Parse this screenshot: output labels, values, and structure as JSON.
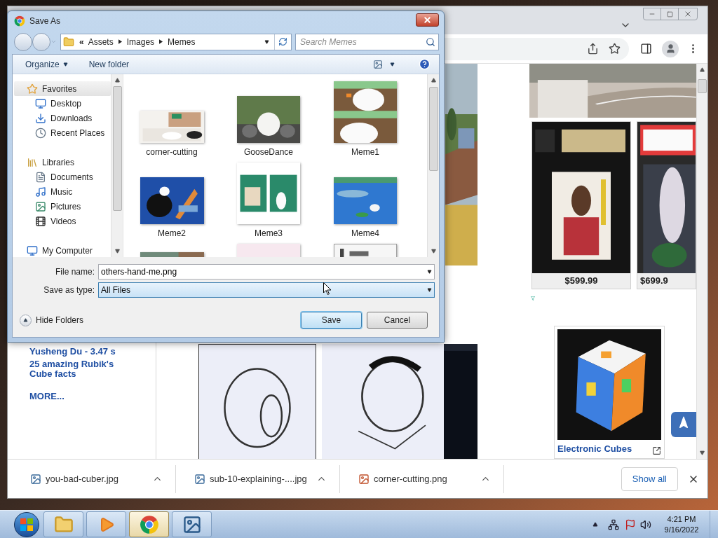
{
  "dialog": {
    "title": "Save As",
    "breadcrumb": {
      "overflow": "«",
      "folders": [
        "Assets",
        "Images",
        "Memes"
      ]
    },
    "search": {
      "placeholder": "Search Memes"
    },
    "toolbar": {
      "organize": "Organize",
      "new_folder": "New folder"
    },
    "nav_tree": [
      {
        "label": "Favorites",
        "kind": "favorites",
        "selected": true,
        "children": [
          {
            "label": "Desktop",
            "kind": "desktop",
            "selected": false
          },
          {
            "label": "Downloads",
            "kind": "downloads",
            "selected": false
          },
          {
            "label": "Recent Places",
            "kind": "recent",
            "selected": false
          }
        ]
      },
      {
        "label": "Libraries",
        "kind": "libraries",
        "selected": false,
        "children": [
          {
            "label": "Documents",
            "kind": "documents",
            "selected": false
          },
          {
            "label": "Music",
            "kind": "music",
            "selected": false
          },
          {
            "label": "Pictures",
            "kind": "pictures",
            "selected": false
          },
          {
            "label": "Videos",
            "kind": "videos",
            "selected": false
          }
        ]
      },
      {
        "label": "My Computer",
        "kind": "computer",
        "selected": false
      }
    ],
    "files": [
      {
        "name": "corner-cutting",
        "kind": "picture"
      },
      {
        "name": "GooseDance",
        "kind": "picture"
      },
      {
        "name": "Meme1",
        "kind": "picture"
      },
      {
        "name": "Meme2",
        "kind": "picture"
      },
      {
        "name": "Meme3",
        "kind": "picture"
      },
      {
        "name": "Meme4",
        "kind": "picture"
      },
      {
        "kind": "picture"
      },
      {
        "kind": "picture"
      },
      {
        "kind": "picture"
      }
    ],
    "file_name": {
      "label": "File name:",
      "value": "others-hand-me.png",
      "focused": false
    },
    "save_type": {
      "label": "Save as type:",
      "value": "All Files",
      "focused": true
    },
    "hide_folders": "Hide Folders",
    "buttons": [
      {
        "label": "Save",
        "default": true
      },
      {
        "label": "Cancel",
        "default": false
      }
    ]
  },
  "browser": {
    "sidebar_links": [
      {
        "text": "Yusheng Du - 3.47 s",
        "kind": "article"
      },
      {
        "text": "25 amazing Rubik's Cube facts",
        "kind": "article"
      },
      {
        "text": "MORE...",
        "kind": "more"
      }
    ],
    "products": [
      {
        "price": "$599.99"
      },
      {
        "price": "$699.9"
      }
    ],
    "ad": {
      "title": "Electronic Cubes"
    },
    "downloads": [
      {
        "name": "you-bad-cuber.jpg",
        "kind": "jpg"
      },
      {
        "name": "sub-10-explaining-....jpg",
        "kind": "jpg"
      },
      {
        "name": "corner-cutting.png",
        "kind": "png"
      }
    ],
    "show_all": "Show all"
  },
  "taskbar": {
    "apps": [
      {
        "kind": "explorer",
        "selected": false
      },
      {
        "kind": "media",
        "selected": false
      },
      {
        "kind": "chrome",
        "selected": true
      },
      {
        "kind": "photos",
        "selected": false
      }
    ],
    "clock": {
      "time": "4:21 PM",
      "date": "9/16/2022"
    }
  }
}
